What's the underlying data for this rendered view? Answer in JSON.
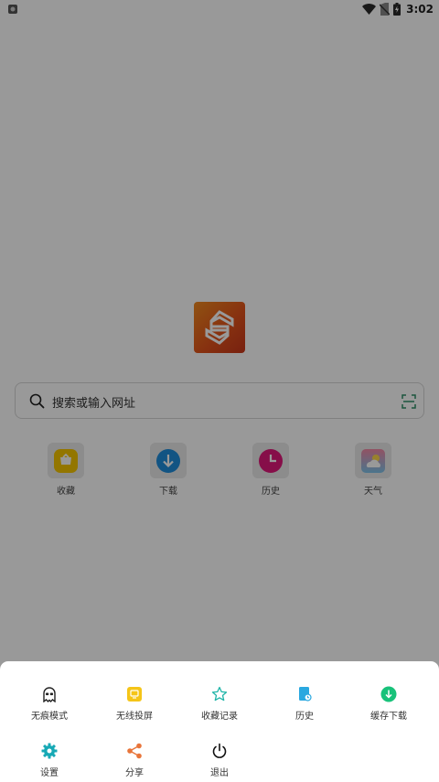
{
  "status_bar": {
    "time": "3:02",
    "icons": [
      "camera-icon",
      "wifi-icon",
      "no-sim-icon",
      "battery-icon"
    ]
  },
  "home": {
    "logo_icon": "s-logo-icon",
    "search": {
      "placeholder": "搜索或输入网址",
      "left_icon": "search-icon",
      "right_icon": "scan-icon"
    },
    "quick_links": [
      {
        "label": "收藏",
        "icon": "bookmark-icon"
      },
      {
        "label": "下载",
        "icon": "download-icon"
      },
      {
        "label": "历史",
        "icon": "history-clock-icon"
      },
      {
        "label": "天气",
        "icon": "weather-icon"
      }
    ]
  },
  "menu": {
    "row1": [
      {
        "label": "无痕模式",
        "icon": "incognito-ghost-icon"
      },
      {
        "label": "无线投屏",
        "icon": "cast-icon"
      },
      {
        "label": "收藏记录",
        "icon": "star-icon"
      },
      {
        "label": "历史",
        "icon": "history-book-icon"
      },
      {
        "label": "缓存下载",
        "icon": "cache-download-icon"
      }
    ],
    "row2": [
      {
        "label": "设置",
        "icon": "settings-gear-icon"
      },
      {
        "label": "分享",
        "icon": "share-icon"
      },
      {
        "label": "退出",
        "icon": "power-icon"
      }
    ]
  },
  "colors": {
    "accent_orange": "#E2541C",
    "dim_overlay": "rgba(0,0,0,0.40)",
    "star_teal": "#1FB5A8",
    "cast_yellow": "#F5C518",
    "history_blue": "#2AA8E0",
    "cache_green": "#18C27A",
    "gear_teal": "#17A9B5",
    "share_orange": "#E8753A"
  }
}
